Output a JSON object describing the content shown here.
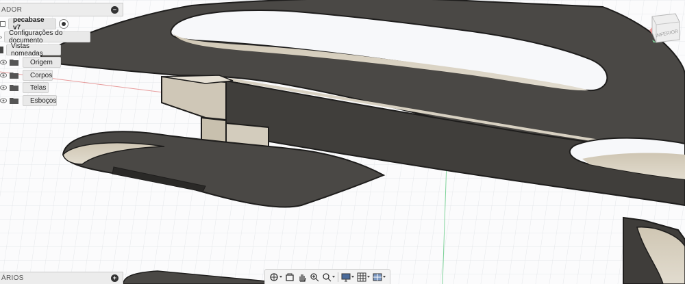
{
  "browser": {
    "header_label": "ADOR",
    "document_name": "pecabase v7",
    "items": [
      {
        "label": "Configurações do documento"
      },
      {
        "label": "Vistas nomeadas"
      },
      {
        "label": "Origem"
      },
      {
        "label": "Corpos"
      },
      {
        "label": "Telas"
      },
      {
        "label": "Esboços"
      }
    ]
  },
  "viewcube": {
    "face_label": "INFERIOR"
  },
  "comments": {
    "label": "ÁRIOS"
  },
  "toolbar": {
    "icons": [
      "orbit-icon",
      "look-at-icon",
      "pan-icon",
      "zoom-icon",
      "fit-icon",
      "display-settings-icon",
      "grid-icon",
      "viewports-icon"
    ]
  },
  "colors": {
    "body": "#4a4845",
    "body_edge": "#2a2927",
    "inner_face": "#d6cfc0",
    "grid": "#dadde2",
    "axis_red": "#e79a9a",
    "axis_green": "#7fd39a"
  }
}
